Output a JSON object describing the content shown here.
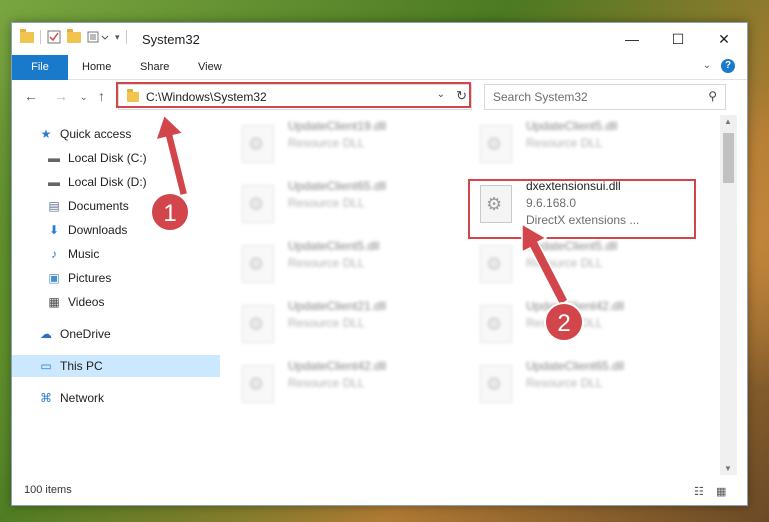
{
  "window": {
    "title": "System32",
    "minimize_icon": "—",
    "maximize_icon": "☐",
    "close_icon": "✕"
  },
  "ribbon": {
    "tabs": [
      "File",
      "Home",
      "Share",
      "View"
    ],
    "help": "?",
    "chevron": "⌄"
  },
  "address": {
    "path": "C:\\Windows\\System32",
    "search_placeholder": "Search System32"
  },
  "sidebar": {
    "items": [
      {
        "label": "Quick access",
        "icon": "★"
      },
      {
        "label": "Local Disk (C:)",
        "icon": "▬",
        "pinned": true
      },
      {
        "label": "Local Disk (D:)",
        "icon": "▬",
        "pinned": true
      },
      {
        "label": "Documents",
        "icon": "▤",
        "pinned": true
      },
      {
        "label": "Downloads",
        "icon": "⬇",
        "pinned": true
      },
      {
        "label": "Music",
        "icon": "♪",
        "pinned": true
      },
      {
        "label": "Pictures",
        "icon": "▣",
        "pinned": true
      },
      {
        "label": "Videos",
        "icon": "▦",
        "pinned": true
      },
      {
        "label": "OneDrive",
        "icon": "☁"
      },
      {
        "label": "This PC",
        "icon": "▭"
      },
      {
        "label": "Network",
        "icon": "⌘"
      }
    ],
    "pin_icon": "📌"
  },
  "files": [
    {
      "name": "UpdateClient19.dll",
      "line2": "Resource DLL",
      "line3": ""
    },
    {
      "name": "UpdateClient5.dll",
      "line2": "Resource DLL",
      "line3": ""
    },
    {
      "name": "UpdateClient65.dll",
      "line2": "Resource DLL",
      "line3": ""
    },
    {
      "name": "dxextensionsui.dll",
      "line2": "9.6.168.0",
      "line3": "DirectX extensions ..."
    },
    {
      "name": "UpdateClient5.dll",
      "line2": "Resource DLL",
      "line3": ""
    },
    {
      "name": "UpdateClient5.dll",
      "line2": "Resource DLL",
      "line3": ""
    },
    {
      "name": "UpdateClient21.dll",
      "line2": "Resource DLL",
      "line3": ""
    },
    {
      "name": "UpdateClient42.dll",
      "line2": "Resource DLL",
      "line3": ""
    },
    {
      "name": "UpdateClient42.dll",
      "line2": "Resource DLL",
      "line3": ""
    },
    {
      "name": "UpdateClient65.dll",
      "line2": "Resource DLL",
      "line3": ""
    }
  ],
  "status": {
    "items_count": "100 items"
  },
  "annotations": {
    "step1": "1",
    "step2": "2",
    "highlight_color": "#d2454b"
  }
}
